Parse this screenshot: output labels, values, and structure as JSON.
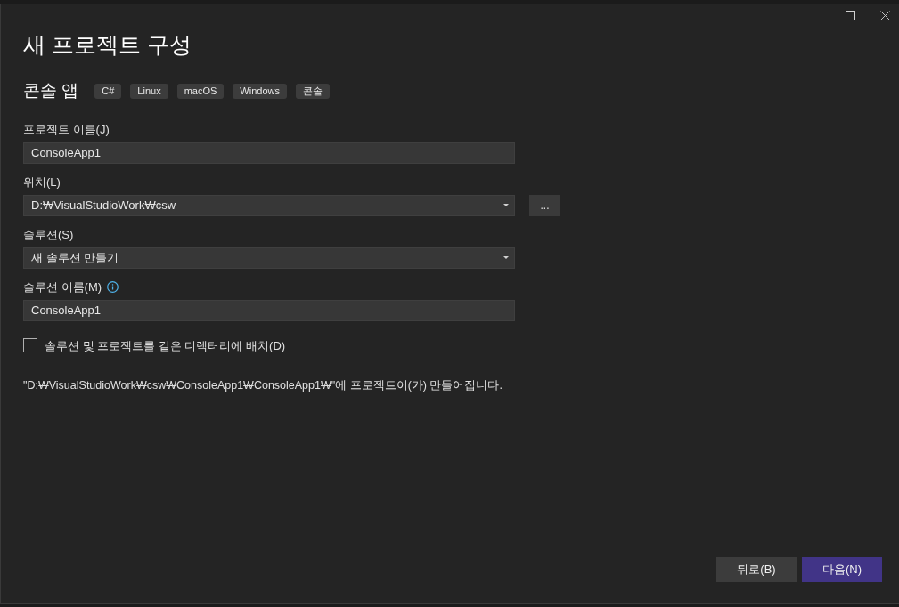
{
  "window": {
    "title": "새 프로젝트 구성"
  },
  "template": {
    "name": "콘솔 앱",
    "tags": [
      "C#",
      "Linux",
      "macOS",
      "Windows",
      "콘솔"
    ]
  },
  "fields": [
    {
      "kind": "text",
      "label": "프로젝트 이름(J)",
      "value": "ConsoleApp1",
      "info": false
    },
    {
      "kind": "dropdown",
      "label": "위치(L)",
      "value": "D:₩VisualStudioWork₩csw",
      "browse": "...",
      "info": false
    },
    {
      "kind": "dropdown",
      "label": "솔루션(S)",
      "value": "새 솔루션 만들기",
      "info": false
    },
    {
      "kind": "text",
      "label": "솔루션 이름(M)",
      "value": "ConsoleApp1",
      "info": true
    }
  ],
  "same_directory": {
    "label": "솔루션 및 프로젝트를 같은 디렉터리에 배치(D)",
    "checked": false
  },
  "summary": "\"D:₩VisualStudioWork₩csw₩ConsoleApp1₩ConsoleApp1₩\"에 프로젝트이(가) 만들어집니다.",
  "buttons": [
    {
      "label": "뒤로(B)",
      "primary": false
    },
    {
      "label": "다음(N)",
      "primary": true
    }
  ]
}
